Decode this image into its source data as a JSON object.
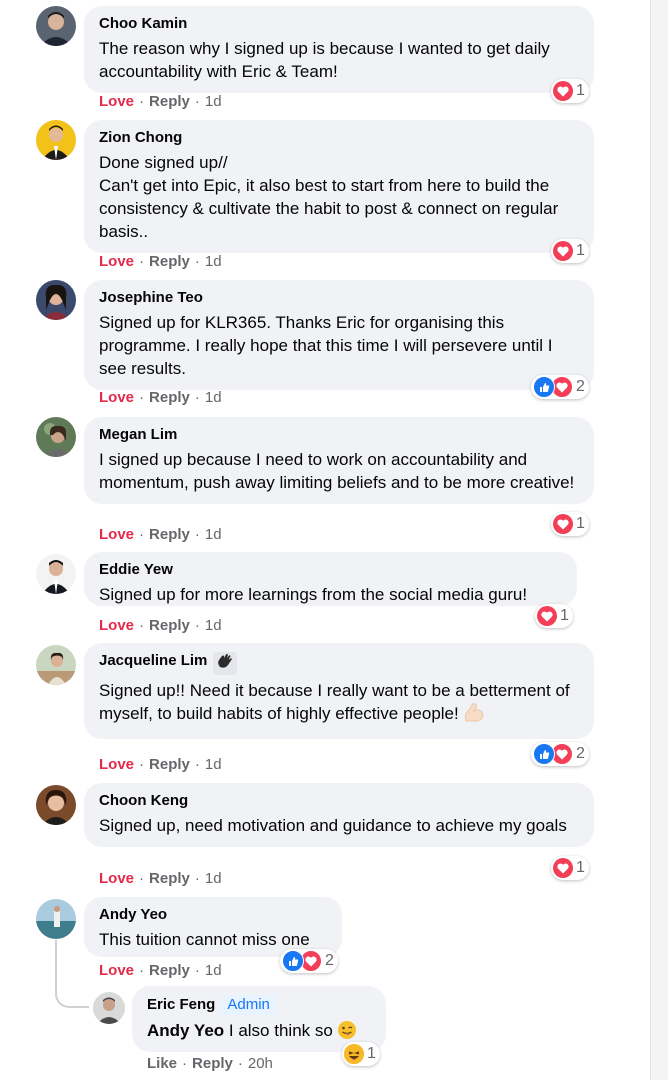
{
  "comments": [
    {
      "name": "Choo Kamin",
      "text": "The reason why I signed up is because I wanted to get daily accountability with Eric & Team!",
      "love": "Love",
      "reply": "Reply",
      "time": "1d",
      "reaction_count": "1"
    },
    {
      "name": "Zion Chong",
      "text": "Done signed up//\nCan't get into Epic, it also best to start from here to build the consistency & cultivate the habit to post & connect on regular basis..",
      "love": "Love",
      "reply": "Reply",
      "time": "1d",
      "reaction_count": "1"
    },
    {
      "name": "Josephine Teo",
      "text": "Signed up for KLR365. Thanks Eric for organising this programme. I really hope that this time I will persevere until I see results.",
      "love": "Love",
      "reply": "Reply",
      "time": "1d",
      "reaction_count": "2"
    },
    {
      "name": "Megan Lim",
      "text": "I signed up because I need to work on accountability and momentum, push away limiting beliefs and to be more creative!",
      "love": "Love",
      "reply": "Reply",
      "time": "1d",
      "reaction_count": "1"
    },
    {
      "name": "Eddie Yew",
      "text": "Signed up for more learnings from the social media guru!",
      "love": "Love",
      "reply": "Reply",
      "time": "1d",
      "reaction_count": "1"
    },
    {
      "name": "Jacqueline Lim",
      "text": "Signed up!! Need it because I really want to be a betterment of myself, to build habits of highly effective people!",
      "love": "Love",
      "reply": "Reply",
      "time": "1d",
      "reaction_count": "2"
    },
    {
      "name": "Choon Keng",
      "text": "Signed up, need motivation and guidance to achieve my goals",
      "love": "Love",
      "reply": "Reply",
      "time": "1d",
      "reaction_count": "1"
    },
    {
      "name": "Andy Yeo",
      "text": "This tuition cannot miss one",
      "love": "Love",
      "reply": "Reply",
      "time": "1d",
      "reaction_count": "2"
    }
  ],
  "reply": {
    "name": "Eric Feng",
    "badge": "Admin",
    "mention": "Andy Yeo",
    "text": " I also think so",
    "like": "Like",
    "reply": "Reply",
    "time": "20h",
    "reaction_count": "1"
  },
  "colors": {
    "love": "#e4294b",
    "like_blue": "#1877f2",
    "heart_red": "#f33e58",
    "bubble": "#f0f2f5"
  },
  "icons": [
    "waving-hand-icon",
    "flexed-biceps-icon",
    "winking-tongue-icon",
    "heart-reaction-icon",
    "like-reaction-icon",
    "haha-reaction-icon"
  ]
}
